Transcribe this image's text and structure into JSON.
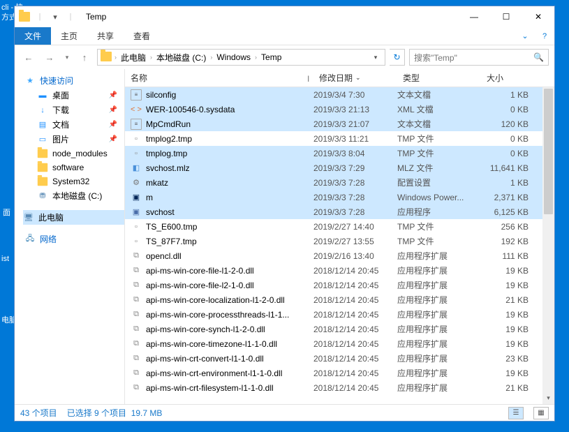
{
  "desktop": {
    "frag1": "cli - 快",
    "frag2": "方式",
    "frag3": "面",
    "frag4": "ist",
    "frag5": "电脑"
  },
  "titlebar": {
    "title": "Temp",
    "qat_dropdown": "▾",
    "min": "—",
    "max": "☐",
    "close": "✕"
  },
  "ribbon": {
    "file": "文件",
    "home": "主页",
    "share": "共享",
    "view": "查看",
    "expand": "⌄",
    "help": "?"
  },
  "nav": {
    "back": "←",
    "fwd": "→",
    "hist": "▾",
    "up": "↑",
    "refresh": "↻"
  },
  "breadcrumb": {
    "root": "此电脑",
    "d2": "本地磁盘 (C:)",
    "d3": "Windows",
    "d4": "Temp",
    "sep": "›",
    "drop": "▾"
  },
  "search": {
    "placeholder": "搜索\"Temp\"",
    "icon": "🔍"
  },
  "sidebar": {
    "quick": "快速访问",
    "items": [
      {
        "label": "桌面",
        "icon": "blue",
        "glyph": "▬"
      },
      {
        "label": "下载",
        "icon": "blue",
        "glyph": "↓"
      },
      {
        "label": "文档",
        "icon": "blue",
        "glyph": "▤"
      },
      {
        "label": "图片",
        "icon": "blue",
        "glyph": "▭"
      },
      {
        "label": "node_modules",
        "icon": "ylw",
        "glyph": ""
      },
      {
        "label": "software",
        "icon": "ylw",
        "glyph": ""
      },
      {
        "label": "System32",
        "icon": "ylw",
        "glyph": ""
      },
      {
        "label": "本地磁盘 (C:)",
        "icon": "pc",
        "glyph": "⛃"
      }
    ],
    "this_pc": "此电脑",
    "network": "网络",
    "pin": "📌"
  },
  "columns": {
    "name": "名称",
    "date": "修改日期",
    "type": "类型",
    "size": "大小",
    "sort_desc": "⌄"
  },
  "files": [
    {
      "sel": true,
      "ico": "txt",
      "name": "silconfig",
      "date": "2019/3/4 7:30",
      "type": "文本文檔",
      "size": "1 KB"
    },
    {
      "sel": true,
      "ico": "xml",
      "name": "WER-100546-0.sysdata",
      "date": "2019/3/3 21:13",
      "type": "XML 文檔",
      "size": "0 KB"
    },
    {
      "sel": true,
      "ico": "txt",
      "name": "MpCmdRun",
      "date": "2019/3/3 21:07",
      "type": "文本文檔",
      "size": "120 KB"
    },
    {
      "sel": false,
      "ico": "tmp",
      "name": "tmplog2.tmp",
      "date": "2019/3/3 11:21",
      "type": "TMP 文件",
      "size": "0 KB"
    },
    {
      "sel": true,
      "ico": "tmp",
      "name": "tmplog.tmp",
      "date": "2019/3/3 8:04",
      "type": "TMP 文件",
      "size": "0 KB"
    },
    {
      "sel": true,
      "ico": "mlz",
      "name": "svchost.mlz",
      "date": "2019/3/3 7:29",
      "type": "MLZ 文件",
      "size": "11,641 KB"
    },
    {
      "sel": true,
      "ico": "cfg",
      "name": "mkatz",
      "date": "2019/3/3 7:28",
      "type": "配置设置",
      "size": "1 KB"
    },
    {
      "sel": true,
      "ico": "ps",
      "name": "m",
      "date": "2019/3/3 7:28",
      "type": "Windows Power...",
      "size": "2,371 KB"
    },
    {
      "sel": true,
      "ico": "exe",
      "name": "svchost",
      "date": "2019/3/3 7:28",
      "type": "应用程序",
      "size": "6,125 KB"
    },
    {
      "sel": false,
      "ico": "tmp",
      "name": "TS_E600.tmp",
      "date": "2019/2/27 14:40",
      "type": "TMP 文件",
      "size": "256 KB"
    },
    {
      "sel": false,
      "ico": "tmp",
      "name": "TS_87F7.tmp",
      "date": "2019/2/27 13:55",
      "type": "TMP 文件",
      "size": "192 KB"
    },
    {
      "sel": false,
      "ico": "dll",
      "name": "opencl.dll",
      "date": "2019/2/16 13:40",
      "type": "应用程序扩展",
      "size": "111 KB"
    },
    {
      "sel": false,
      "ico": "dll",
      "name": "api-ms-win-core-file-l1-2-0.dll",
      "date": "2018/12/14 20:45",
      "type": "应用程序扩展",
      "size": "19 KB"
    },
    {
      "sel": false,
      "ico": "dll",
      "name": "api-ms-win-core-file-l2-1-0.dll",
      "date": "2018/12/14 20:45",
      "type": "应用程序扩展",
      "size": "19 KB"
    },
    {
      "sel": false,
      "ico": "dll",
      "name": "api-ms-win-core-localization-l1-2-0.dll",
      "date": "2018/12/14 20:45",
      "type": "应用程序扩展",
      "size": "21 KB"
    },
    {
      "sel": false,
      "ico": "dll",
      "name": "api-ms-win-core-processthreads-l1-1...",
      "date": "2018/12/14 20:45",
      "type": "应用程序扩展",
      "size": "19 KB"
    },
    {
      "sel": false,
      "ico": "dll",
      "name": "api-ms-win-core-synch-l1-2-0.dll",
      "date": "2018/12/14 20:45",
      "type": "应用程序扩展",
      "size": "19 KB"
    },
    {
      "sel": false,
      "ico": "dll",
      "name": "api-ms-win-core-timezone-l1-1-0.dll",
      "date": "2018/12/14 20:45",
      "type": "应用程序扩展",
      "size": "19 KB"
    },
    {
      "sel": false,
      "ico": "dll",
      "name": "api-ms-win-crt-convert-l1-1-0.dll",
      "date": "2018/12/14 20:45",
      "type": "应用程序扩展",
      "size": "23 KB"
    },
    {
      "sel": false,
      "ico": "dll",
      "name": "api-ms-win-crt-environment-l1-1-0.dll",
      "date": "2018/12/14 20:45",
      "type": "应用程序扩展",
      "size": "19 KB"
    },
    {
      "sel": false,
      "ico": "dll",
      "name": "api-ms-win-crt-filesystem-l1-1-0.dll",
      "date": "2018/12/14 20:45",
      "type": "应用程序扩展",
      "size": "21 KB"
    }
  ],
  "status": {
    "count": "43 个项目",
    "selected": "已选择 9 个项目",
    "size": "19.7 MB"
  }
}
